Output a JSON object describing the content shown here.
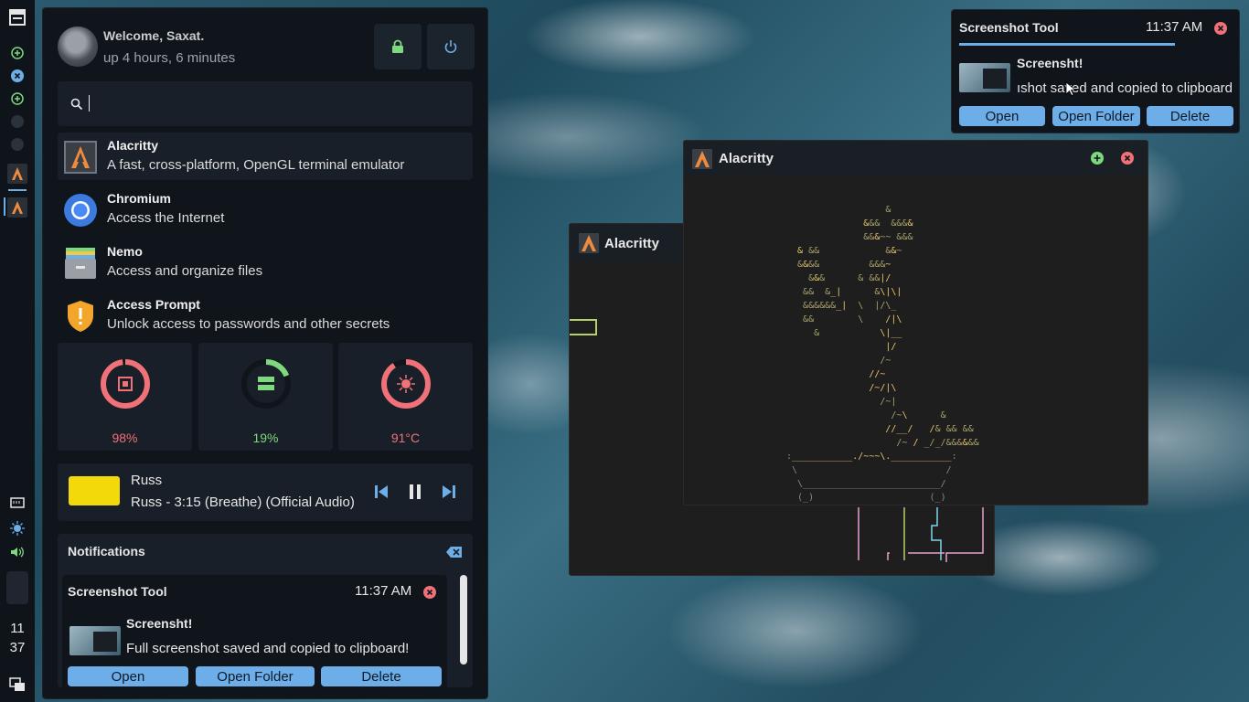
{
  "dock": {
    "clock_hour": "11",
    "clock_minute": "37"
  },
  "launcher": {
    "welcome": "Welcome, Saxat.",
    "uptime": "up 4 hours, 6 minutes",
    "search_value": "",
    "apps": [
      {
        "name": "Alacritty",
        "desc": "A fast, cross-platform, OpenGL terminal emulator"
      },
      {
        "name": "Chromium",
        "desc": "Access the Internet"
      },
      {
        "name": "Nemo",
        "desc": "Access and organize files"
      },
      {
        "name": "Access Prompt",
        "desc": "Unlock access to passwords and other secrets"
      }
    ],
    "stats": {
      "cpu": "98%",
      "cpu_level": 0.98,
      "storage": "19%",
      "storage_level": 0.19,
      "temp": "91°C",
      "temp_level": 0.91
    },
    "media": {
      "artist": "Russ",
      "track": "Russ - 3:15 (Breathe) (Official Audio)"
    },
    "notifications": {
      "heading": "Notifications",
      "item": {
        "app": "Screenshot Tool",
        "time": "11:37 AM",
        "title": "Screensht!",
        "body": "Full screenshot saved and copied to clipboard!",
        "actions": [
          "Open",
          "Open Folder",
          "Delete"
        ]
      }
    }
  },
  "toast": {
    "app": "Screenshot Tool",
    "time": "11:37 AM",
    "title": "Screensht!",
    "body": "ıshot saved and copied to clipboard",
    "actions": [
      "Open",
      "Open Folder",
      "Delete"
    ]
  },
  "windows": {
    "back_title": "Alacritty",
    "front_title": "Alacritty"
  },
  "colors": {
    "accent": "#6eaee8",
    "danger": "#f07178",
    "success": "#7ed87e",
    "panel": "#10151c",
    "card": "#181f28"
  }
}
